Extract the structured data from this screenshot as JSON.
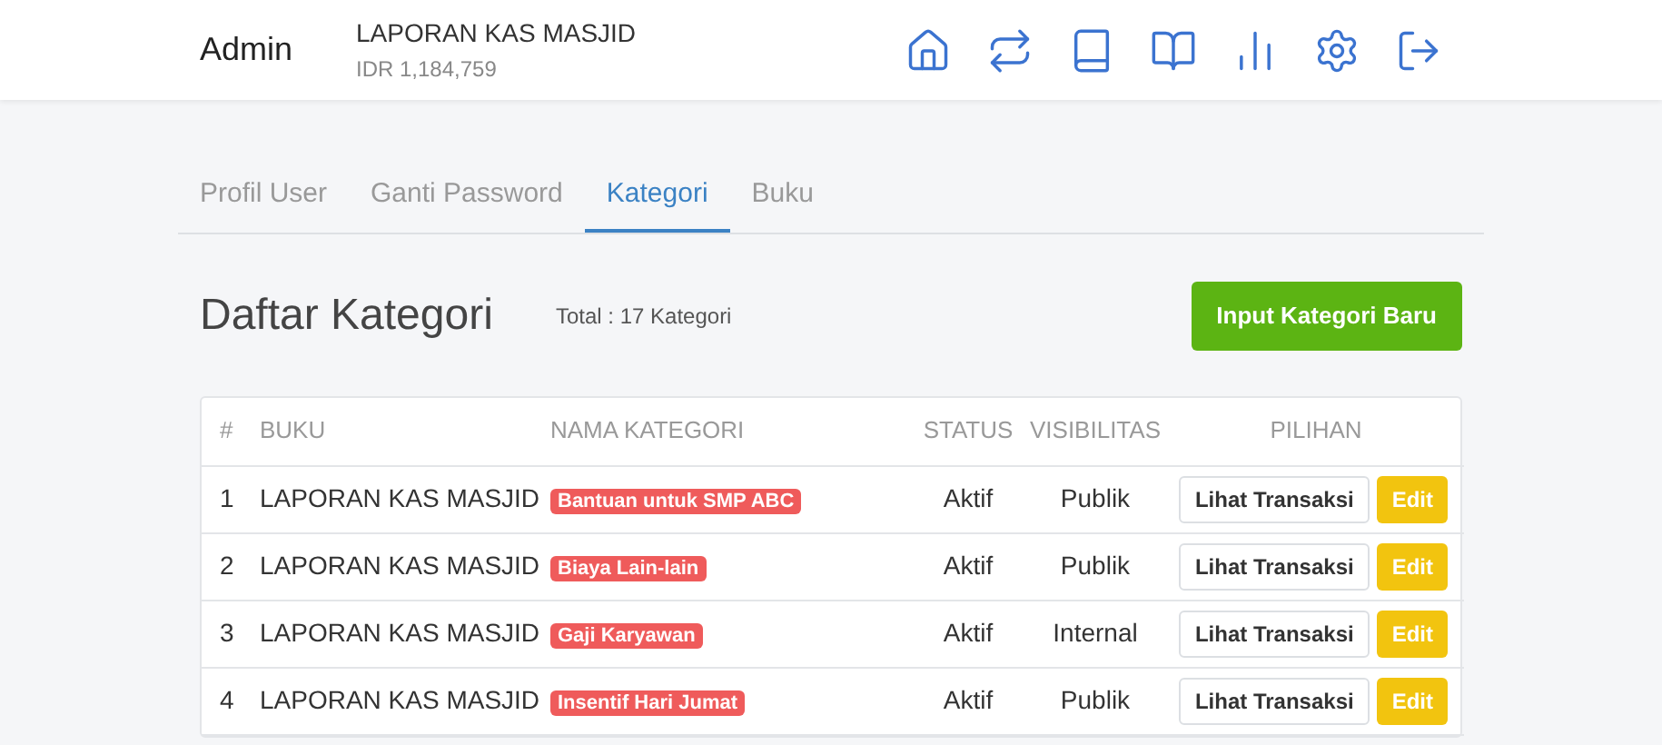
{
  "header": {
    "brand": "Admin",
    "book_title": "LAPORAN KAS MASJID",
    "balance": "IDR 1,184,759"
  },
  "tabs": [
    {
      "label": "Profil User",
      "selected": false
    },
    {
      "label": "Ganti Password",
      "selected": false
    },
    {
      "label": "Kategori",
      "selected": true
    },
    {
      "label": "Buku",
      "selected": false
    }
  ],
  "page": {
    "title": "Daftar Kategori",
    "total": "Total : 17 Kategori",
    "new_button": "Input Kategori Baru"
  },
  "table": {
    "columns": [
      "#",
      "BUKU",
      "NAMA KATEGORI",
      "STATUS",
      "VISIBILITAS",
      "PILIHAN"
    ],
    "rows": [
      {
        "no": "1",
        "book": "LAPORAN KAS MASJID",
        "category": "Bantuan untuk SMP ABC",
        "status": "Aktif",
        "visibility": "Publik",
        "view_button": "Lihat Transaksi",
        "edit_button": "Edit"
      },
      {
        "no": "2",
        "book": "LAPORAN KAS MASJID",
        "category": "Biaya Lain-lain",
        "status": "Aktif",
        "visibility": "Publik",
        "view_button": "Lihat Transaksi",
        "edit_button": "Edit"
      },
      {
        "no": "3",
        "book": "LAPORAN KAS MASJID",
        "category": "Gaji Karyawan",
        "status": "Aktif",
        "visibility": "Internal",
        "view_button": "Lihat Transaksi",
        "edit_button": "Edit"
      },
      {
        "no": "4",
        "book": "LAPORAN KAS MASJID",
        "category": "Insentif Hari Jumat",
        "status": "Aktif",
        "visibility": "Publik",
        "view_button": "Lihat Transaksi",
        "edit_button": "Edit"
      }
    ]
  }
}
